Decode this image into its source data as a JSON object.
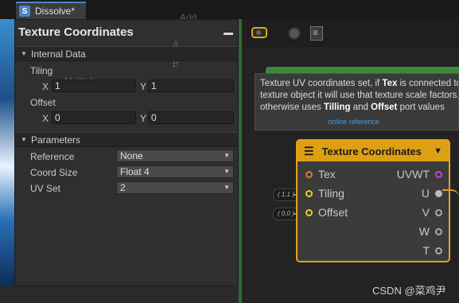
{
  "tab": {
    "title": "Dissolve*",
    "icon": "S"
  },
  "ghost_labels": {
    "add": "Add",
    "a": "A",
    "b": "B",
    "multiply": "Multiply"
  },
  "panel": {
    "title": "Texture Coordinates",
    "internal_section": "Internal Data",
    "tiling_label": "Tiling",
    "tiling_x_label": "X",
    "tiling_x": "1",
    "tiling_y_label": "Y",
    "tiling_y": "1",
    "offset_label": "Offset",
    "offset_x_label": "X",
    "offset_x": "0",
    "offset_y_label": "Y",
    "offset_y": "0",
    "params_section": "Parameters",
    "reference_label": "Reference",
    "reference_value": "None",
    "coord_size_label": "Coord Size",
    "coord_size_value": "Float 4",
    "uv_set_label": "UV Set",
    "uv_set_value": "2"
  },
  "tooltip": {
    "l1a": "Texture UV coordinates set, if ",
    "l1b": "Tex",
    "l1c": " is connected to a",
    "l2": "texture object it will use that texture scale factors,",
    "l3a": "otherwise uses ",
    "l3b": "Tilling",
    "l3c": " and ",
    "l3d": "Offset",
    "l3e": " port values",
    "link": "online reference"
  },
  "node": {
    "title": "Texture Coordinates",
    "inputs": [
      "Tex",
      "Tiling",
      "Offset"
    ],
    "outputs": [
      "UVWT",
      "U",
      "V",
      "W",
      "T"
    ],
    "tiling_default": "( 1,1 )",
    "offset_default": "( 0,0 )"
  },
  "watermark": "CSDN @菜鸡尹",
  "colors": {
    "accent_node": "#dda012",
    "tab_accent": "#4a86c6",
    "graph_border": "#2e6b2e"
  }
}
